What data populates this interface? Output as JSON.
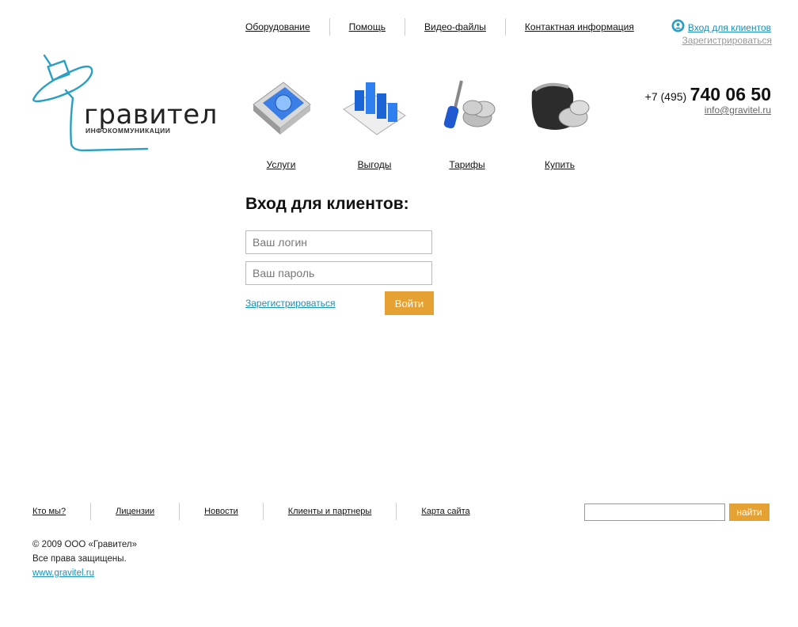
{
  "topnav": {
    "items": [
      "Оборудование",
      "Помощь",
      "Видео-файлы",
      "Контактная информация"
    ]
  },
  "client": {
    "login_link": "Вход для клиентов",
    "register_link": "Зарегистрироваться"
  },
  "logo": {
    "title": "гравител",
    "subtitle": "ИНФОКОММУНИКАЦИИ"
  },
  "contacts": {
    "phone_code": "+7 (495)",
    "phone_number": "740 06 50",
    "email": "info@gravitel.ru"
  },
  "iconmenu": {
    "items": [
      {
        "label": "Услуги",
        "icon": "book-icon"
      },
      {
        "label": "Выгоды",
        "icon": "chart-icon"
      },
      {
        "label": "Тарифы",
        "icon": "screwdriver-coins-icon"
      },
      {
        "label": "Купить",
        "icon": "wallet-coins-icon"
      }
    ]
  },
  "login": {
    "title": "Вход для клиентов:",
    "login_placeholder": "Ваш логин",
    "password_placeholder": "Ваш пароль",
    "register_link": "Зарегистрироваться",
    "submit_label": "Войти"
  },
  "footer": {
    "nav": [
      "Кто мы?",
      "Лицензии",
      "Новости",
      "Клиенты и партнеры",
      "Карта сайта"
    ],
    "search_button": "найти",
    "copyright": "© 2009 ООО «Гравител»",
    "rights": "Все права защищены.",
    "site": "www.gravitel.ru"
  },
  "colors": {
    "accent": "#e6a133",
    "link_blue": "#1b8fb8",
    "logo_blue": "#2a9fc4"
  }
}
